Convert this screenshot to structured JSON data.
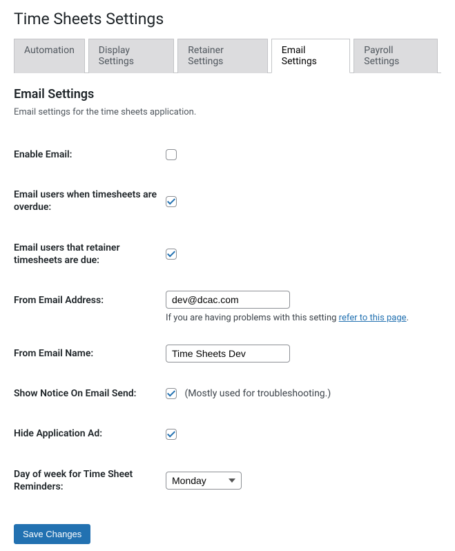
{
  "page_title": "Time Sheets Settings",
  "tabs": [
    {
      "label": "Automation",
      "active": false
    },
    {
      "label": "Display Settings",
      "active": false
    },
    {
      "label": "Retainer Settings",
      "active": false
    },
    {
      "label": "Email Settings",
      "active": true
    },
    {
      "label": "Payroll Settings",
      "active": false
    }
  ],
  "section": {
    "title": "Email Settings",
    "description": "Email settings for the time sheets application."
  },
  "fields": {
    "enable_email": {
      "label": "Enable Email:",
      "checked": false
    },
    "email_overdue": {
      "label": "Email users when timesheets are overdue:",
      "checked": true
    },
    "email_retainer": {
      "label": "Email users that retainer timesheets are due:",
      "checked": true
    },
    "from_email": {
      "label": "From Email Address:",
      "value": "dev@dcac.com",
      "help_prefix": "If you are having problems with this setting ",
      "help_link": "refer to this page",
      "help_suffix": "."
    },
    "from_name": {
      "label": "From Email Name:",
      "value": "Time Sheets Dev"
    },
    "show_notice": {
      "label": "Show Notice On Email Send:",
      "checked": true,
      "note": "(Mostly used for troubleshooting.)"
    },
    "hide_ad": {
      "label": "Hide Application Ad:",
      "checked": true
    },
    "reminder_day": {
      "label": "Day of week for Time Sheet Reminders:",
      "value": "Monday"
    }
  },
  "save_button": "Save Changes"
}
